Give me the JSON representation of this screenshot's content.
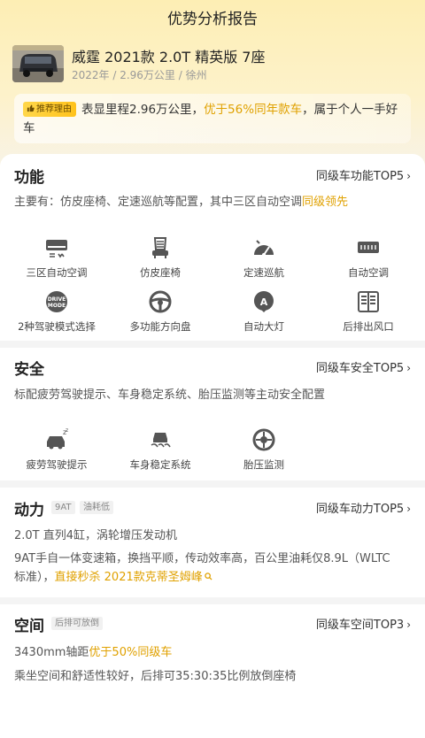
{
  "header": {
    "title": "优势分析报告"
  },
  "car": {
    "name": "威霆 2021款 2.0T 精英版 7座",
    "meta": "2022年 / 2.96万公里 / 徐州"
  },
  "reason": {
    "tag": "推荐理由",
    "text_a": "表显里程2.96万公里，",
    "highlight": "优于56%同年款车",
    "text_b": "，属于个人一手好车"
  },
  "function": {
    "title": "功能",
    "top_link": "同级车功能TOP5",
    "desc_a": "主要有：仿皮座椅、定速巡航等配置，其中三区自动空调",
    "desc_hl": "同级领先",
    "features": [
      {
        "label": "三区自动空调",
        "icon": "ac-three-zone-icon"
      },
      {
        "label": "仿皮座椅",
        "icon": "leather-seat-icon"
      },
      {
        "label": "定速巡航",
        "icon": "cruise-control-icon"
      },
      {
        "label": "自动空调",
        "icon": "auto-ac-icon"
      },
      {
        "label": "2种驾驶模式选择",
        "icon": "drive-mode-icon"
      },
      {
        "label": "多功能方向盘",
        "icon": "steering-wheel-icon"
      },
      {
        "label": "自动大灯",
        "icon": "auto-headlight-icon"
      },
      {
        "label": "后排出风口",
        "icon": "rear-vent-icon"
      }
    ],
    "drive_mode_text": "DRIVE MODE"
  },
  "safety": {
    "title": "安全",
    "top_link": "同级车安全TOP5",
    "desc": "标配疲劳驾驶提示、车身稳定系统、胎压监测等主动安全配置",
    "features": [
      {
        "label": "疲劳驾驶提示",
        "icon": "fatigue-alert-icon"
      },
      {
        "label": "车身稳定系统",
        "icon": "stability-control-icon"
      },
      {
        "label": "胎压监测",
        "icon": "tire-pressure-icon"
      }
    ]
  },
  "power": {
    "title": "动力",
    "tags": [
      "9AT",
      "油耗低"
    ],
    "top_link": "同级车动力TOP5",
    "line1": "2.0T 直列4缸，涡轮增压发动机",
    "line2a": "9AT手自一体变速箱，换挡平顺，传动效率高，百公里油耗仅8.9L（WLTC",
    "line2b": "标准），",
    "link": "直接秒杀 2021款克蒂圣姆峰"
  },
  "space": {
    "title": "空间",
    "tag": "后排可放倒",
    "top_link": "同级车空间TOP3",
    "line1a": "3430mm轴距",
    "line1hl": "优于50%同级车",
    "line2": "乘坐空间和舒适性较好，后排可35:30:35比例放倒座椅"
  },
  "colors": {
    "accent": "#e0a100",
    "tag_bg": "#ffc21b",
    "header_bg": "#fdeeb4"
  }
}
